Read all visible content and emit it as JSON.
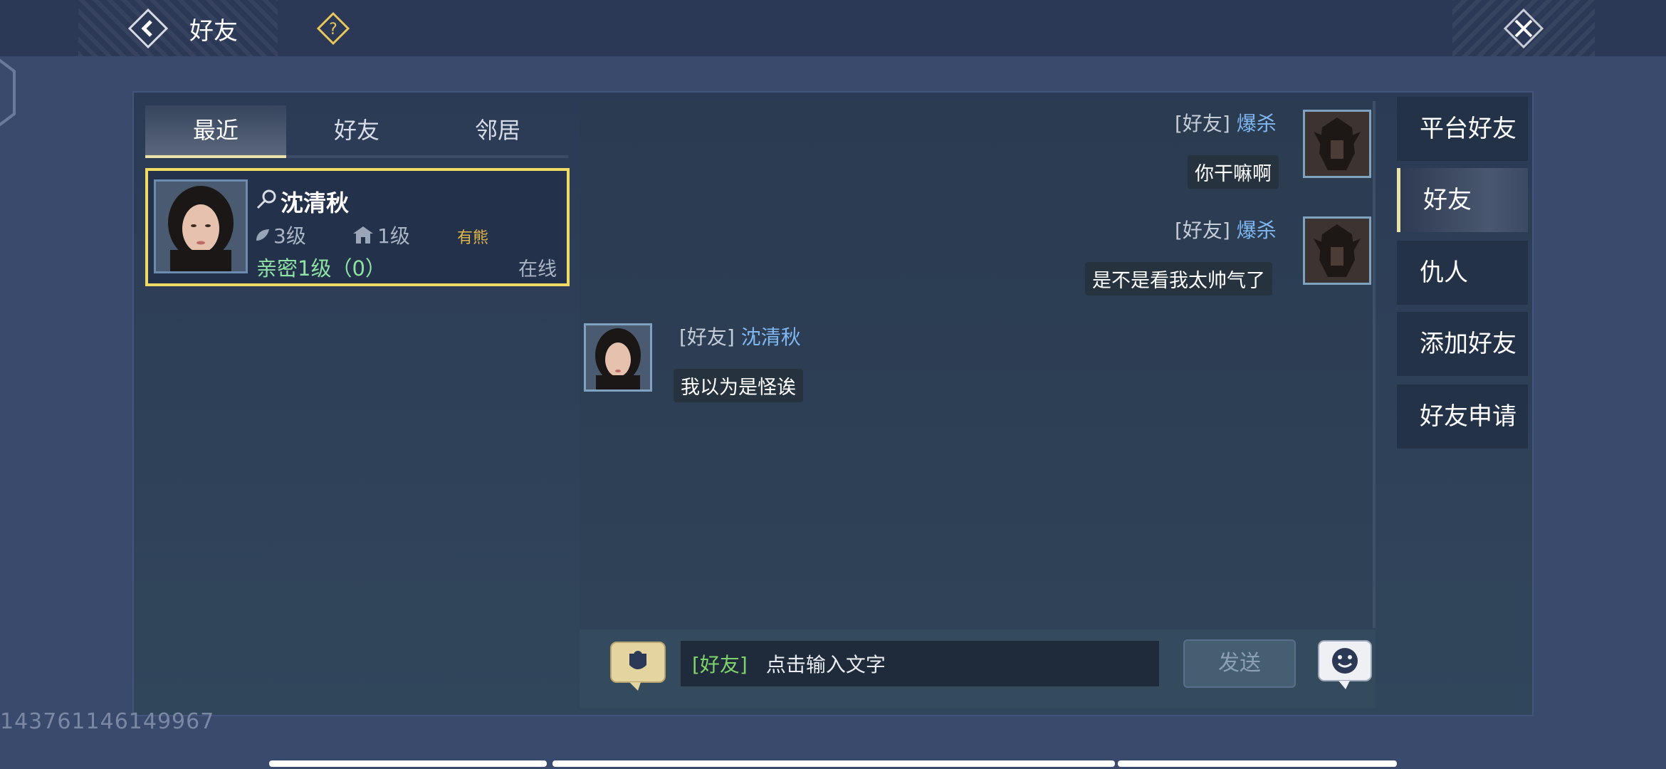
{
  "header": {
    "title": "好友",
    "back_icon": "back-arrow-icon",
    "help_icon": "question-mark-icon",
    "close_icon": "close-x-icon"
  },
  "tabs": [
    {
      "label": "最近",
      "active": true
    },
    {
      "label": "好友",
      "active": false
    },
    {
      "label": "邻居",
      "active": false
    }
  ],
  "friend_card": {
    "name": "沈清秋",
    "level_a": "3级",
    "level_b": "1级",
    "mood": "有熊",
    "intimacy": "亲密1级（0）",
    "status": "在线"
  },
  "messages": [
    {
      "channel": "[好友]",
      "nick": "爆杀",
      "text": "你干嘛啊",
      "side": "right"
    },
    {
      "channel": "[好友]",
      "nick": "爆杀",
      "text": "是不是看我太帅气了",
      "side": "right"
    },
    {
      "channel": "[好友]",
      "nick": "沈清秋",
      "text": "我以为是怪诶",
      "side": "left"
    }
  ],
  "input": {
    "channel": "[好友]",
    "placeholder": "点击输入文字",
    "send_label": "发送"
  },
  "right_menu": [
    {
      "label": "平台好友",
      "active": false
    },
    {
      "label": "好友",
      "active": true
    },
    {
      "label": "仇人",
      "active": false
    },
    {
      "label": "添加好友",
      "active": false
    },
    {
      "label": "好友申请",
      "active": false
    }
  ],
  "uid": "143761146149967",
  "colors": {
    "accent_yellow": "#eedb63",
    "nick_blue": "#7fb7f2",
    "intimacy_green": "#8ee2a4",
    "channel_green": "#7fd36c"
  }
}
